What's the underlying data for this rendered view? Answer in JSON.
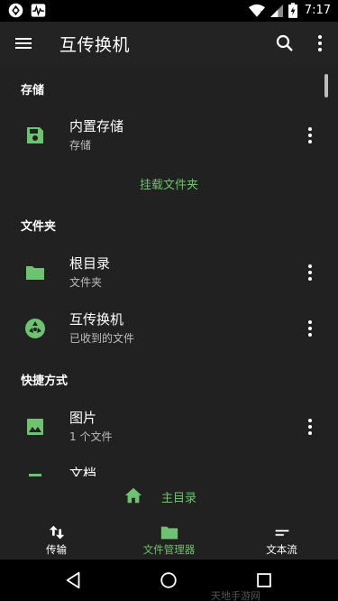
{
  "status_bar": {
    "time": "7:17"
  },
  "app_bar": {
    "title": "互传换机",
    "menu_icon": "menu-icon",
    "search_icon": "search-icon",
    "more_icon": "more-vert-icon"
  },
  "sections": {
    "storage": {
      "header": "存储",
      "items": [
        {
          "title": "内置存储",
          "subtitle": "存储",
          "icon": "save-icon"
        }
      ],
      "mount_label": "挂载文件夹"
    },
    "folders": {
      "header": "文件夹",
      "items": [
        {
          "title": "根目录",
          "subtitle": "文件夹",
          "icon": "folder-icon"
        },
        {
          "title": "互传换机",
          "subtitle": "已收到的文件",
          "icon": "app-logo-icon"
        }
      ]
    },
    "shortcuts": {
      "header": "快捷方式",
      "items": [
        {
          "title": "图片",
          "subtitle": "1 个文件",
          "icon": "image-icon"
        },
        {
          "title": "文档",
          "subtitle": "",
          "icon": "document-icon"
        }
      ]
    }
  },
  "home_bar": {
    "label": "主目录",
    "icon": "home-icon"
  },
  "bottom_nav": [
    {
      "label": "传输",
      "icon": "swap-vert-icon",
      "active": false
    },
    {
      "label": "文件管理器",
      "icon": "folder-icon",
      "active": true
    },
    {
      "label": "文本流",
      "icon": "short-text-icon",
      "active": false
    }
  ],
  "watermark": "天地手游网",
  "colors": {
    "accent": "#6dc36f",
    "background": "#212121",
    "appbar": "#232323",
    "status_bar": "#000000"
  }
}
